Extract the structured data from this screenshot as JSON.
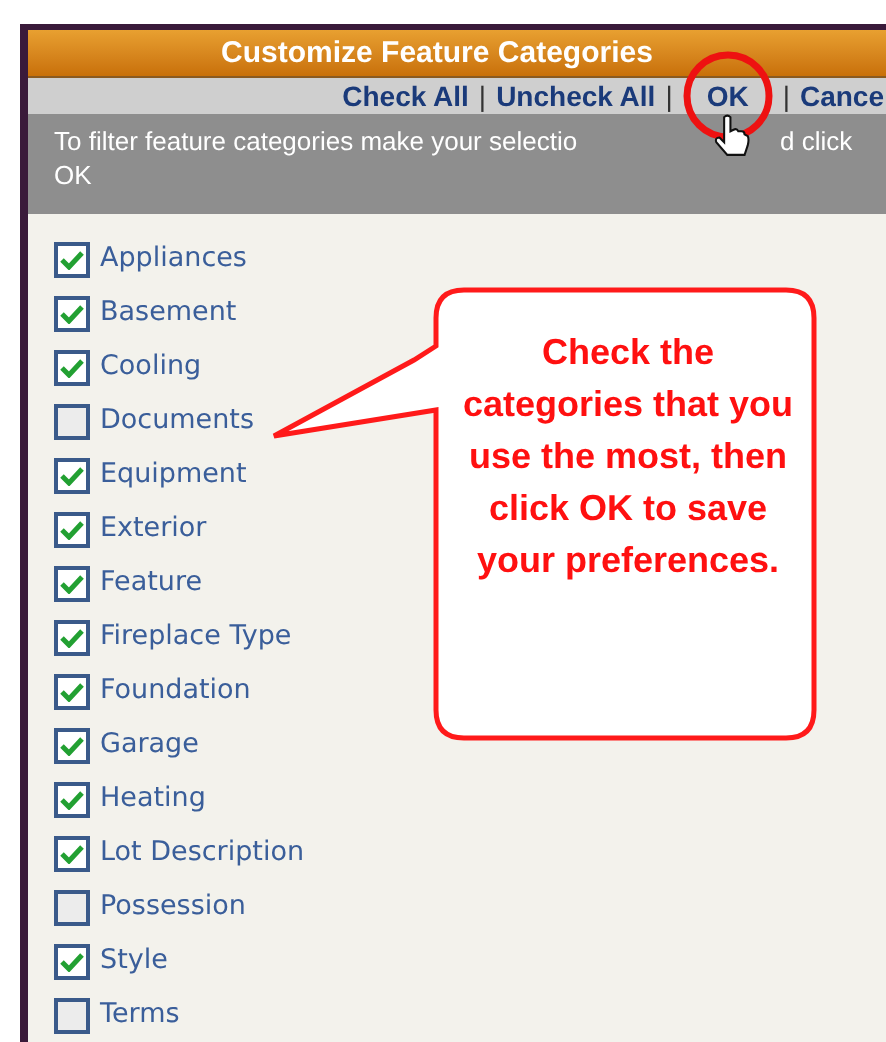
{
  "dialog": {
    "title": "Customize Feature Categories",
    "links": [
      {
        "kind": "link",
        "text": "Check All"
      },
      {
        "kind": "separator",
        "text": "|"
      },
      {
        "kind": "link",
        "text": "Uncheck All"
      },
      {
        "kind": "separator",
        "text": "|"
      },
      {
        "kind": "circled-link",
        "text": "OK"
      },
      {
        "kind": "separator",
        "text": "|"
      },
      {
        "kind": "link",
        "text": "Cance"
      }
    ],
    "instructions": [
      "To filter feature categories make your selectio",
      "d click",
      "OK"
    ]
  },
  "categories": [
    {
      "label": "Appliances",
      "checked": true
    },
    {
      "label": "Basement",
      "checked": true
    },
    {
      "label": "Cooling",
      "checked": true
    },
    {
      "label": "Documents",
      "checked": false
    },
    {
      "label": "Equipment",
      "checked": true
    },
    {
      "label": "Exterior",
      "checked": true
    },
    {
      "label": "Feature",
      "checked": true
    },
    {
      "label": "Fireplace Type",
      "checked": true
    },
    {
      "label": "Foundation",
      "checked": true
    },
    {
      "label": "Garage",
      "checked": true
    },
    {
      "label": "Heating",
      "checked": true
    },
    {
      "label": "Lot Description",
      "checked": true
    },
    {
      "label": "Possession",
      "checked": false
    },
    {
      "label": "Style",
      "checked": true
    },
    {
      "label": "Terms",
      "checked": false
    }
  ],
  "callout": {
    "text": "Check the categories that you use the most, then click OK to save your preferences."
  }
}
